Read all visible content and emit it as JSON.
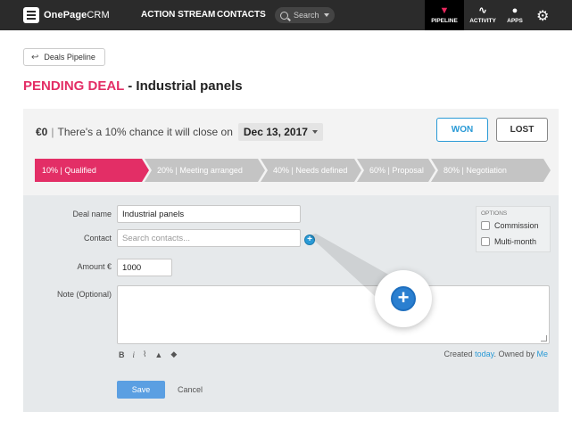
{
  "topbar": {
    "logo_bold": "OnePage",
    "logo_light": "CRM",
    "nav": [
      "ACTION STREAM",
      "CONTACTS"
    ],
    "search_placeholder": "Search",
    "tools": [
      {
        "label": "PIPELINE",
        "icon": "pipeline-icon",
        "active": true
      },
      {
        "label": "ACTIVITY",
        "icon": "activity-icon",
        "active": false
      },
      {
        "label": "APPS",
        "icon": "apps-icon",
        "active": false
      }
    ],
    "settings_icon": "gear-icon"
  },
  "back_label": "Deals Pipeline",
  "title": {
    "status": "PENDING DEAL",
    "separator": " - ",
    "name": "Industrial panels"
  },
  "summary": {
    "amount": "€0",
    "sep": "|",
    "chance_text": "There's a 10% chance it will close on",
    "close_date": "Dec 13, 2017",
    "won_label": "WON",
    "lost_label": "LOST"
  },
  "pipeline": {
    "stages": [
      {
        "label": "10% | Qualified",
        "active": true
      },
      {
        "label": "20% | Meeting arranged",
        "active": false
      },
      {
        "label": "40% | Needs defined",
        "active": false
      },
      {
        "label": "60% | Proposal",
        "active": false
      },
      {
        "label": "80% | Negotiation",
        "active": false
      }
    ]
  },
  "form": {
    "deal_name_label": "Deal name",
    "deal_name_value": "Industrial panels",
    "contact_label": "Contact",
    "contact_placeholder": "Search contacts...",
    "amount_label": "Amount €",
    "amount_value": "1000",
    "note_label": "Note (Optional)",
    "options_title": "OPTIONS",
    "option_commission": "Commission",
    "option_multimonth": "Multi-month",
    "meta_created": "Created",
    "meta_today": "today",
    "meta_owned": ". Owned by",
    "meta_me": "Me",
    "save_label": "Save",
    "cancel_label": "Cancel"
  },
  "colors": {
    "accent_pink": "#e32e66",
    "accent_blue": "#2a9ad6",
    "topbar": "#2b2b2b",
    "stage_inactive": "#c4c4c4"
  }
}
